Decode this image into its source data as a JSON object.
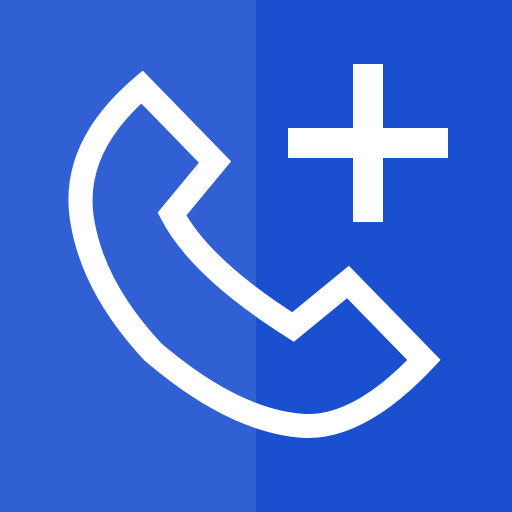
{
  "icon": {
    "name": "phone-add-app-icon",
    "glyphs": [
      "phone-handset-icon",
      "plus-icon"
    ],
    "colors": {
      "background": "#1A4FD0",
      "highlight": "#3E6FDD",
      "glyph": "#FFFFFF"
    }
  }
}
